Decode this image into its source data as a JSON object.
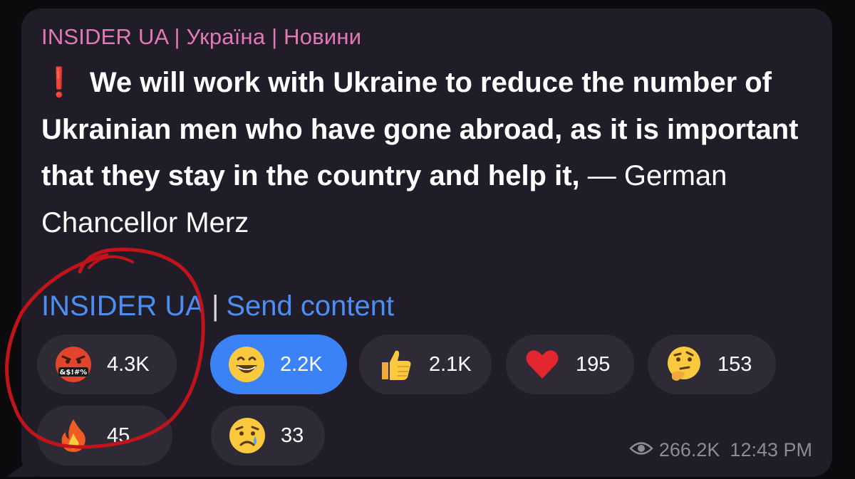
{
  "post": {
    "sender": "INSIDER UA | Україна | Новини",
    "exclamation": "❗",
    "bold_text": "We will work with Ukraine to reduce the number of Ukrainian men who have gone abroad, as it is important that they stay in the country and help it,",
    "regular_text": " — German Chancellor Merz"
  },
  "links": {
    "channel": "INSIDER UA",
    "separator": "|",
    "send_content": "Send content"
  },
  "reactions": [
    {
      "icon": "cursing-face-icon",
      "count": "4.3K",
      "active": false
    },
    {
      "icon": "grinning-face-icon",
      "count": "2.2K",
      "active": true
    },
    {
      "icon": "thumbs-up-icon",
      "count": "2.1K",
      "active": false
    },
    {
      "icon": "red-heart-icon",
      "count": "195",
      "active": false
    },
    {
      "icon": "thinking-face-icon",
      "count": "153",
      "active": false
    },
    {
      "icon": "fire-icon",
      "count": "45",
      "active": false
    },
    {
      "icon": "crying-face-icon",
      "count": "33",
      "active": false
    }
  ],
  "meta": {
    "views": "266.2K",
    "time": "12:43 PM"
  },
  "colors": {
    "bubble": "#201d28",
    "sender": "#e279b6",
    "link": "#4c8ff4",
    "active_reaction": "#3b82f6",
    "annotation": "#c0141a"
  }
}
